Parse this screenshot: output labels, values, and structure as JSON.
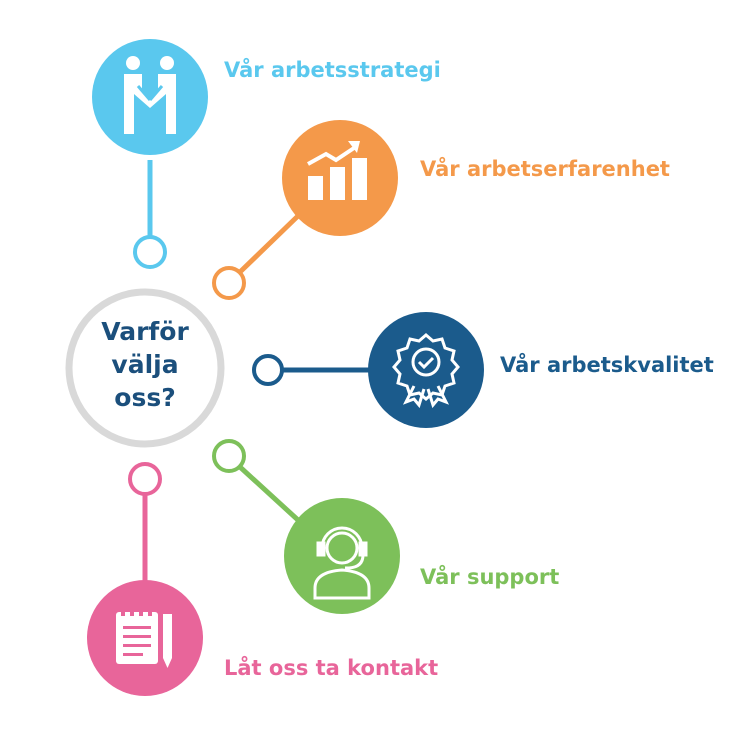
{
  "center": {
    "line1": "Varför",
    "line2": "välja",
    "line3": "oss?"
  },
  "items": [
    {
      "label": "Vår arbetsstrategi",
      "icon": "handshake-icon",
      "color": "#5ac8ee"
    },
    {
      "label": "Vår arbetserfarenhet",
      "icon": "growth-chart-icon",
      "color": "#f4994a"
    },
    {
      "label": "Vår arbetskvalitet",
      "icon": "quality-badge-icon",
      "color": "#1b5b8c"
    },
    {
      "label": "Vår support",
      "icon": "support-headset-icon",
      "color": "#7dc05a"
    },
    {
      "label": "Låt oss ta kontakt",
      "icon": "notepad-pen-icon",
      "color": "#e8659a"
    }
  ],
  "center_ring_color": "#d9d9d9",
  "text_color": "#1b4f7c"
}
